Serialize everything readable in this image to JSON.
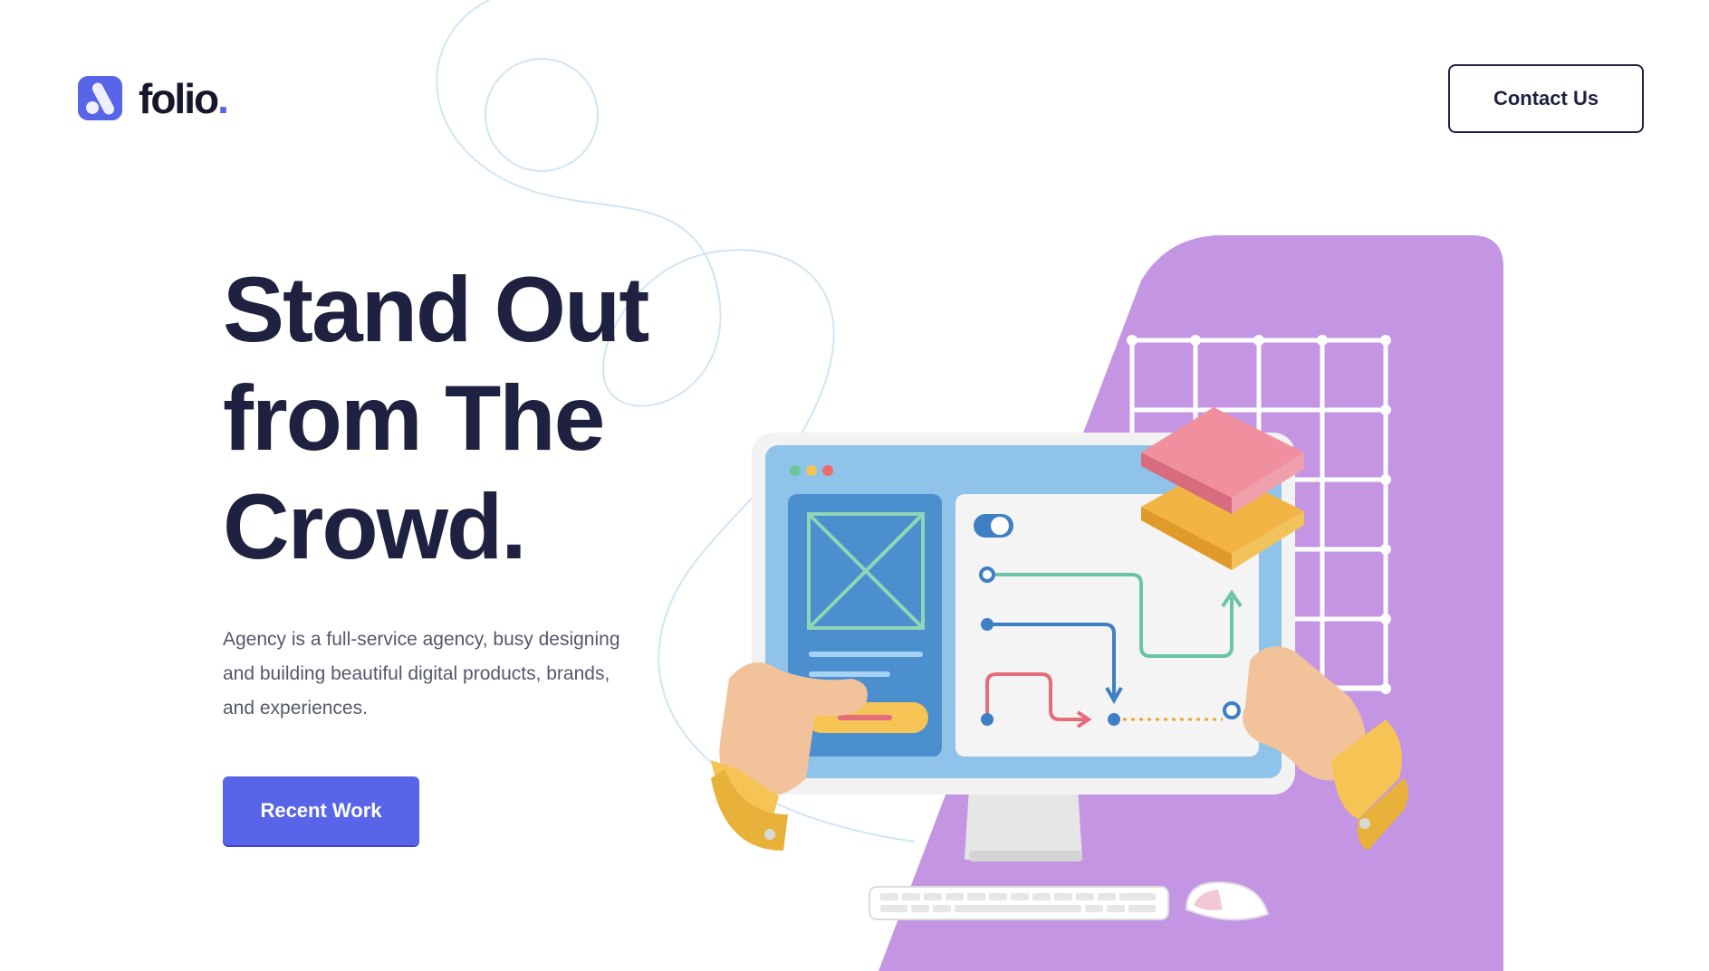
{
  "header": {
    "logo_text": "folio",
    "logo_dot": ".",
    "contact_label": "Contact Us"
  },
  "hero": {
    "title_lines": [
      "Stand Out",
      "from The",
      "Crowd."
    ],
    "description_lines": [
      "Agency is a full-service agency, busy designing",
      "and building beautiful digital products, brands,",
      "and experiences."
    ],
    "cta_label": "Recent Work"
  },
  "colors": {
    "brand": "#5865e8",
    "heading": "#1f2140",
    "body_text": "#55586b",
    "panel_purple": "#c495e3",
    "squiggle": "#cfe6f5"
  },
  "illustration": {
    "icons": [
      "monitor-icon",
      "hand-icon",
      "keyboard-icon",
      "mouse-icon",
      "grid-icon",
      "layers-icon"
    ]
  }
}
